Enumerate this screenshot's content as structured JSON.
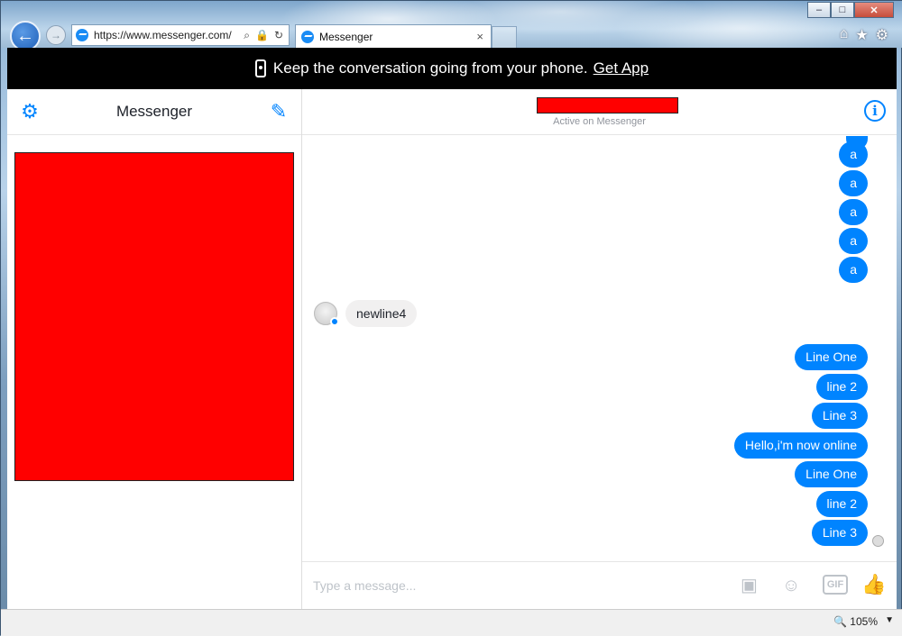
{
  "browser": {
    "url": "https://www.messenger.com/",
    "tab_title": "Messenger",
    "tab_close": "×",
    "back_glyph": "←",
    "forward_glyph": "→",
    "tools": [
      "⌂",
      "★",
      "⚙"
    ],
    "caption": {
      "minimize": "–",
      "maximize": "□",
      "close": "✕"
    },
    "zoom": "105%"
  },
  "banner": {
    "text": "Keep the conversation going from your phone.",
    "link": "Get App"
  },
  "sidebar": {
    "title": "Messenger",
    "settings_glyph": "⚙",
    "compose_glyph": "✎"
  },
  "thread": {
    "status": "Active on Messenger",
    "info_glyph": "i",
    "incoming": "newline4",
    "outgoing_top": [
      "a",
      "a",
      "a",
      "a",
      "a"
    ],
    "outgoing_bottom": [
      "Line One",
      "line 2",
      "Line 3",
      "Hello,i'm now online",
      "Line One",
      "line 2",
      "Line 3"
    ]
  },
  "composer": {
    "placeholder": "Type a message...",
    "gif": "GIF",
    "emoji_glyph": "☺",
    "photo_glyph": "▣",
    "like_glyph": "👍"
  },
  "colors": {
    "accent": "#0084ff",
    "banner_bg": "#000000",
    "redaction": "#ff0000"
  }
}
